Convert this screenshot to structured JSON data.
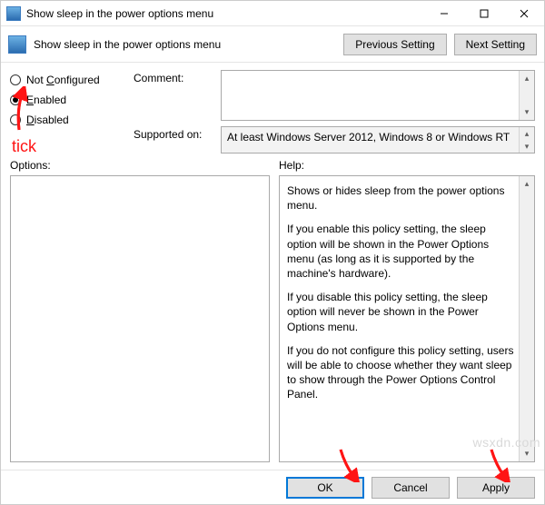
{
  "window": {
    "title": "Show sleep in the power options menu"
  },
  "titlebar_buttons": {
    "minimize": "–",
    "maximize": "▢",
    "close": "✕"
  },
  "header": {
    "subtitle": "Show sleep in the power options menu",
    "previous_setting": "Previous Setting",
    "next_setting": "Next Setting"
  },
  "radios": {
    "not_configured": "Not Configured",
    "enabled": "Enabled",
    "disabled": "Disabled",
    "selected": "enabled"
  },
  "fields": {
    "comment_label": "Comment:",
    "supported_label": "Supported on:",
    "supported_value": "At least Windows Server 2012, Windows 8 or Windows RT"
  },
  "panes": {
    "options_label": "Options:",
    "help_label": "Help:"
  },
  "help_text": {
    "p1": "Shows or hides sleep from the power options menu.",
    "p2": "If you enable this policy setting, the sleep option will be shown in the Power Options menu (as long as it is supported by the machine's hardware).",
    "p3": "If you disable this policy setting, the sleep option will never be shown in the Power Options menu.",
    "p4": "If you do not configure this policy setting, users will be able to choose whether they want sleep to show through the Power Options Control Panel."
  },
  "footer": {
    "ok": "OK",
    "cancel": "Cancel",
    "apply": "Apply"
  },
  "annotations": {
    "tick": "tick"
  },
  "watermark": "wsxdn.com"
}
